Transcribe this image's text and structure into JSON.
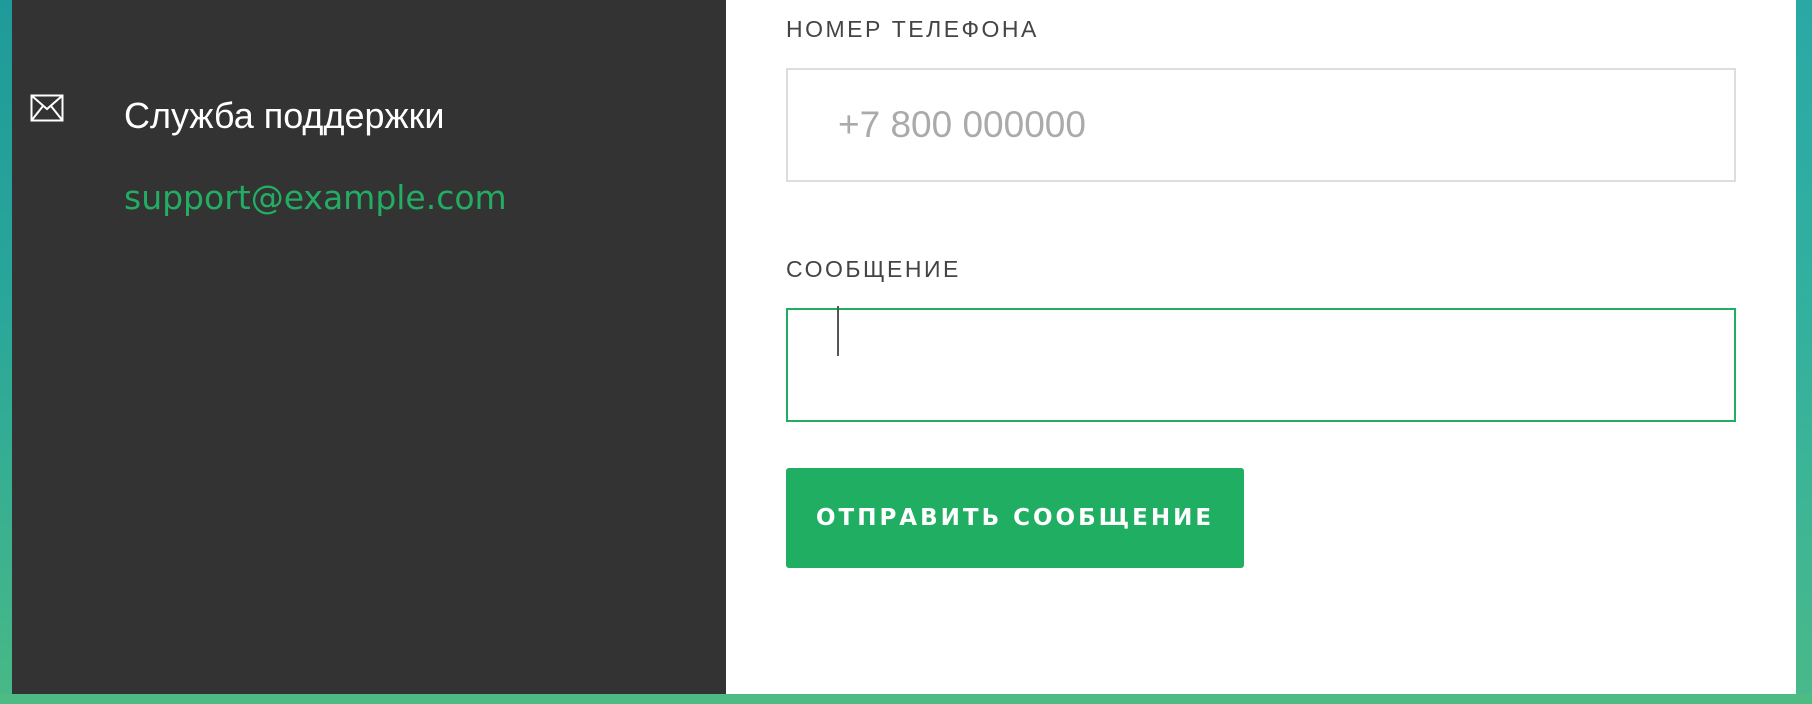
{
  "contact": {
    "support_title": "Служба поддержки",
    "support_email": "support@example.com",
    "icon": "envelope-icon"
  },
  "form": {
    "phone_label": "НОМЕР ТЕЛЕФОНА",
    "phone_placeholder": "+7 800 000000",
    "phone_value": "",
    "message_label": "СООБЩЕНИЕ",
    "message_value": "",
    "submit_label": "ОТПРАВИТЬ СООБЩЕНИЕ"
  },
  "colors": {
    "accent": "#1fae62",
    "dark_panel": "#333333",
    "background_teal": "#2a9d93"
  }
}
